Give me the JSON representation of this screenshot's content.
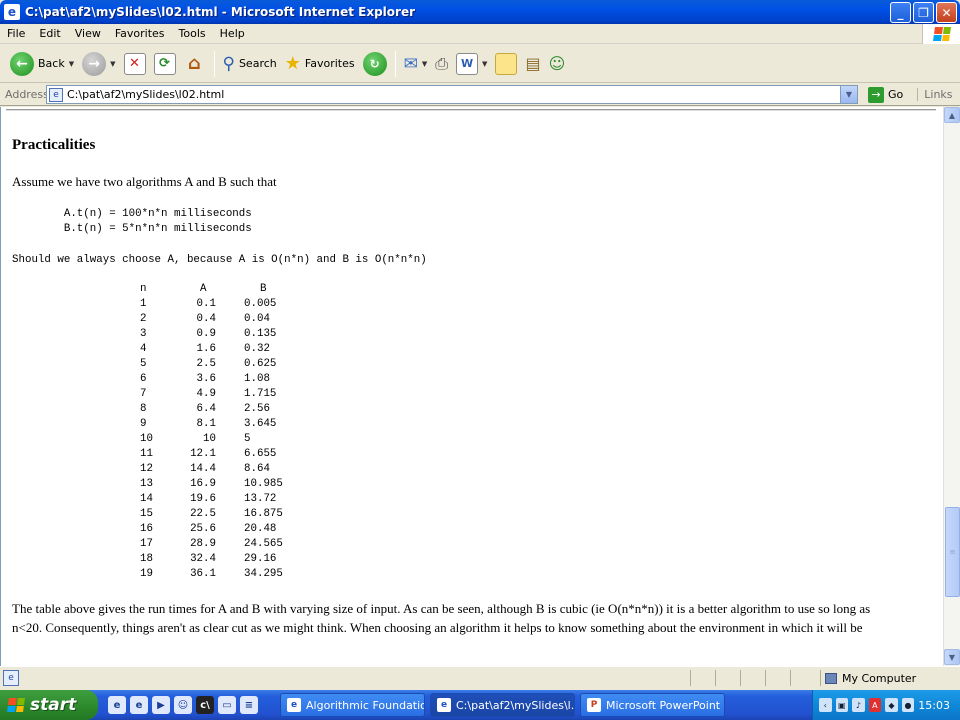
{
  "window": {
    "title": "C:\\pat\\af2\\mySlides\\l02.html - Microsoft Internet Explorer"
  },
  "menu": [
    "File",
    "Edit",
    "View",
    "Favorites",
    "Tools",
    "Help"
  ],
  "toolbar": {
    "back_label": "Back",
    "search_label": "Search",
    "favorites_label": "Favorites"
  },
  "address": {
    "label": "Address",
    "value": "C:\\pat\\af2\\mySlides\\l02.html",
    "go_label": "Go",
    "links_label": "Links"
  },
  "page": {
    "heading": "Practicalities",
    "intro": "Assume we have two algorithms A and B such that",
    "code_line_1": "        A.t(n) = 100*n*n milliseconds",
    "code_line_2": "        B.t(n) = 5*n*n*n milliseconds",
    "question": "Should we always choose A, because A is O(n*n) and B is O(n*n*n)",
    "table": {
      "headers": [
        "n",
        "A",
        "B"
      ],
      "rows": [
        [
          "1",
          "0.1",
          "0.005"
        ],
        [
          "2",
          "0.4",
          "0.04"
        ],
        [
          "3",
          "0.9",
          "0.135"
        ],
        [
          "4",
          "1.6",
          "0.32"
        ],
        [
          "5",
          "2.5",
          "0.625"
        ],
        [
          "6",
          "3.6",
          "1.08"
        ],
        [
          "7",
          "4.9",
          "1.715"
        ],
        [
          "8",
          "6.4",
          "2.56"
        ],
        [
          "9",
          "8.1",
          "3.645"
        ],
        [
          "10",
          "10",
          "5"
        ],
        [
          "11",
          "12.1",
          "6.655"
        ],
        [
          "12",
          "14.4",
          "8.64"
        ],
        [
          "13",
          "16.9",
          "10.985"
        ],
        [
          "14",
          "19.6",
          "13.72"
        ],
        [
          "15",
          "22.5",
          "16.875"
        ],
        [
          "16",
          "25.6",
          "20.48"
        ],
        [
          "17",
          "28.9",
          "24.565"
        ],
        [
          "18",
          "32.4",
          "29.16"
        ],
        [
          "19",
          "36.1",
          "34.295"
        ]
      ]
    },
    "para_line_1": "The table above gives the run times for A and B with varying size of input. As can be seen, although B is cubic (ie O(n*n*n)) it is a better algorithm to use so long as",
    "para_line_2": "n<20. Consequently, things aren't as clear cut as we might think. When choosing an algorithm it helps to know something about the environment in which it will be"
  },
  "status": {
    "zone": "My Computer"
  },
  "taskbar": {
    "start_label": "start",
    "tasks": [
      "Algorithmic Foundatio...",
      "C:\\pat\\af2\\mySlides\\l...",
      "Microsoft PowerPoint ..."
    ],
    "clock": "15:03"
  },
  "icons": {
    "app": "ie-icon",
    "back": "back-arrow-icon",
    "forward": "forward-arrow-icon",
    "stop": "stop-icon",
    "refresh": "refresh-icon",
    "home": "home-icon",
    "search": "search-icon",
    "favorites": "star-icon",
    "history": "history-icon",
    "mail": "mail-icon",
    "print": "print-icon",
    "edit": "edit-icon",
    "discuss": "discuss-icon",
    "research": "research-icon",
    "messenger": "messenger-icon"
  }
}
